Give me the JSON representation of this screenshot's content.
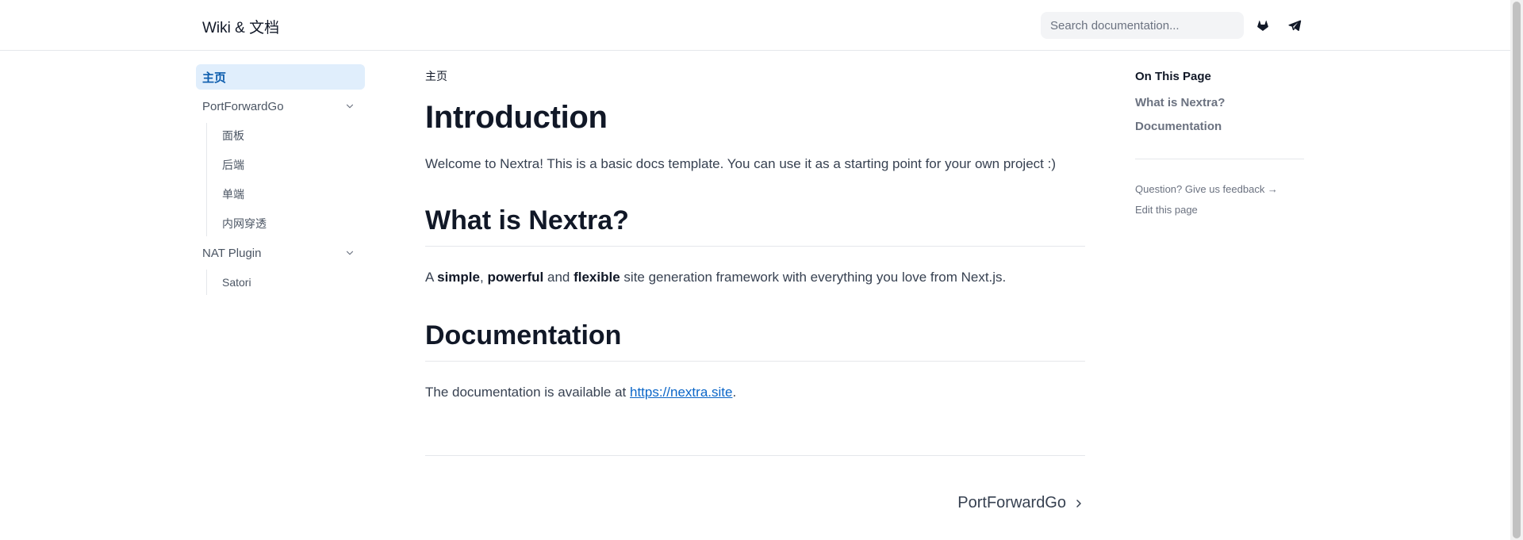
{
  "header": {
    "logo": "Wiki & 文档",
    "search_placeholder": "Search documentation...",
    "icons": [
      "gitlab-icon",
      "telegram-icon"
    ]
  },
  "sidebar": {
    "items": [
      {
        "label": "主页",
        "active": true
      },
      {
        "label": "PortForwardGo",
        "expanded": true,
        "children": [
          "面板",
          "后端",
          "单端",
          "内网穿透"
        ]
      },
      {
        "label": "NAT Plugin",
        "expanded": true,
        "children": [
          "Satori"
        ]
      }
    ]
  },
  "main": {
    "breadcrumb": "主页",
    "title": "Introduction",
    "intro": "Welcome to Nextra! This is a basic docs template. You can use it as a starting point for your own project :)",
    "section1": {
      "heading": "What is Nextra?",
      "text_a": "A ",
      "bold_1": "simple",
      "sep_1": ", ",
      "bold_2": "powerful",
      "sep_2": " and ",
      "bold_3": "flexible",
      "text_b": " site generation framework with everything you love from Next.js."
    },
    "section2": {
      "heading": "Documentation",
      "text_a": "The documentation is available at ",
      "link": "https://nextra.site",
      "text_b": "."
    },
    "next_label": "PortForwardGo"
  },
  "toc": {
    "title": "On This Page",
    "links": [
      "What is Nextra?",
      "Documentation"
    ],
    "feedback": "Question? Give us feedback →",
    "edit": "Edit this page"
  },
  "colors": {
    "accent": "#0b66c8",
    "active_bg": "#e0eefc",
    "active_text": "#0b5cad"
  }
}
